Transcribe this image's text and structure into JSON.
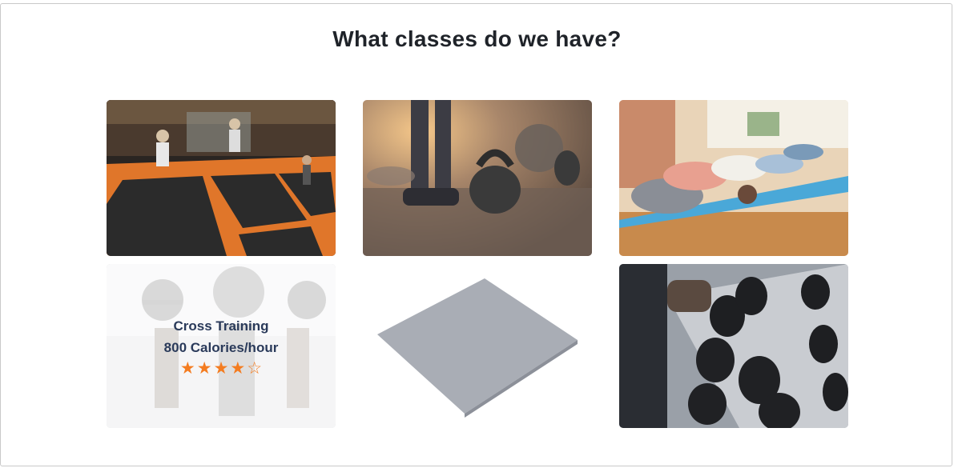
{
  "page": {
    "title": "What classes do we have?"
  },
  "classes": [
    {
      "image": "trampoline-park-photo"
    },
    {
      "image": "kettlebell-photo"
    },
    {
      "image": "yoga-class-photo"
    },
    {
      "image": "cross-training-photo",
      "name": "Cross Training",
      "calories": "800 Calories/hour",
      "rating": 4,
      "max_rating": 5
    },
    {
      "image": "gray-mat-photo"
    },
    {
      "image": "dumbbell-rack-photo"
    }
  ],
  "colors": {
    "star": "#f47c20",
    "title": "#1f2329",
    "overlay_text": "#2a3a5a"
  },
  "icons": {
    "star_filled": "★",
    "star_empty": "☆"
  }
}
